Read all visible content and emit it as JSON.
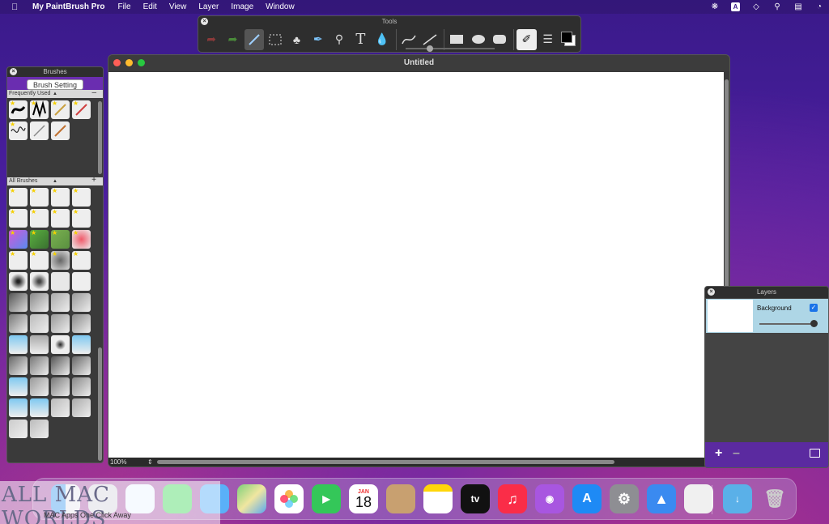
{
  "menubar": {
    "app_name": "My PaintBrush Pro",
    "items": [
      "File",
      "Edit",
      "View",
      "Layer",
      "Image",
      "Window"
    ],
    "input_source": "A"
  },
  "tools": {
    "title": "Tools",
    "buttons": [
      "undo-icon",
      "redo-icon",
      "brush-icon",
      "marquee-select-icon",
      "paint-bucket-icon",
      "eyedropper-icon",
      "zoom-icon",
      "text-icon",
      "water-drop-icon",
      "curve-icon",
      "line-icon",
      "rectangle-icon",
      "ellipse-icon",
      "rounded-rect-icon",
      "brush-palette-icon",
      "layers-icon",
      "color-swatch-icon"
    ],
    "text_tool_label": "T"
  },
  "canvas_window": {
    "title": "Untitled",
    "zoom": "100%"
  },
  "brushes": {
    "title": "Brushes",
    "setting_button": "Brush Setting",
    "frequently_used": "Frequently Used",
    "all_brushes": "All Brushes"
  },
  "layers": {
    "title": "Layers",
    "layer_name": "Background"
  },
  "dock": {
    "calendar_month": "JAN",
    "calendar_day": "18",
    "tv_label": "tv"
  },
  "watermark": {
    "big": "ALL MAC WORLDS",
    "small": "MAC Apps One Click Away"
  },
  "colors": {
    "accent": "#6a2db0",
    "selected_layer": "#aed6e6",
    "checkbox": "#1a73e8"
  }
}
